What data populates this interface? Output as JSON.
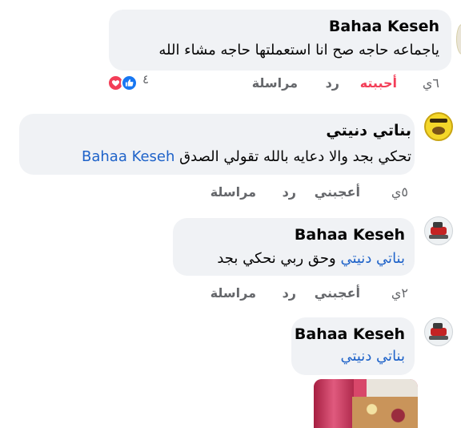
{
  "comments": [
    {
      "author": "Bahaa Keseh",
      "text": "ياجماعه حاجه صح انا استعملتها حاجه مشاء الله",
      "actions": {
        "time": "٦ي",
        "like": "أحببته",
        "reply": "رد",
        "message": "مراسلة"
      },
      "reactions": {
        "count": "٤",
        "types": [
          "like-icon",
          "love-icon"
        ]
      }
    },
    {
      "author": "بناتي دنيتي",
      "text_before": "تحكي بجد والا دعايه بالله تقولي الصدق",
      "mention": "Bahaa Keseh",
      "actions": {
        "time": "٥ي",
        "like": "أعجبني",
        "reply": "رد",
        "message": "مراسلة"
      }
    },
    {
      "author": "Bahaa Keseh",
      "mention": "بناتي دنيتي",
      "text_after": "وحق ربي نحكي بجد",
      "actions": {
        "time": "٢ي",
        "like": "أعجبني",
        "reply": "رد",
        "message": "مراسلة"
      }
    },
    {
      "author": "Bahaa Keseh",
      "mention": "بناتي دنيتي"
    }
  ],
  "colors": {
    "bubble": "#f0f2f5",
    "mention": "#1f63c9",
    "liked": "#f33e58",
    "like_blue": "#1877f2",
    "love_red": "#f33e58",
    "meta": "#65676b"
  }
}
